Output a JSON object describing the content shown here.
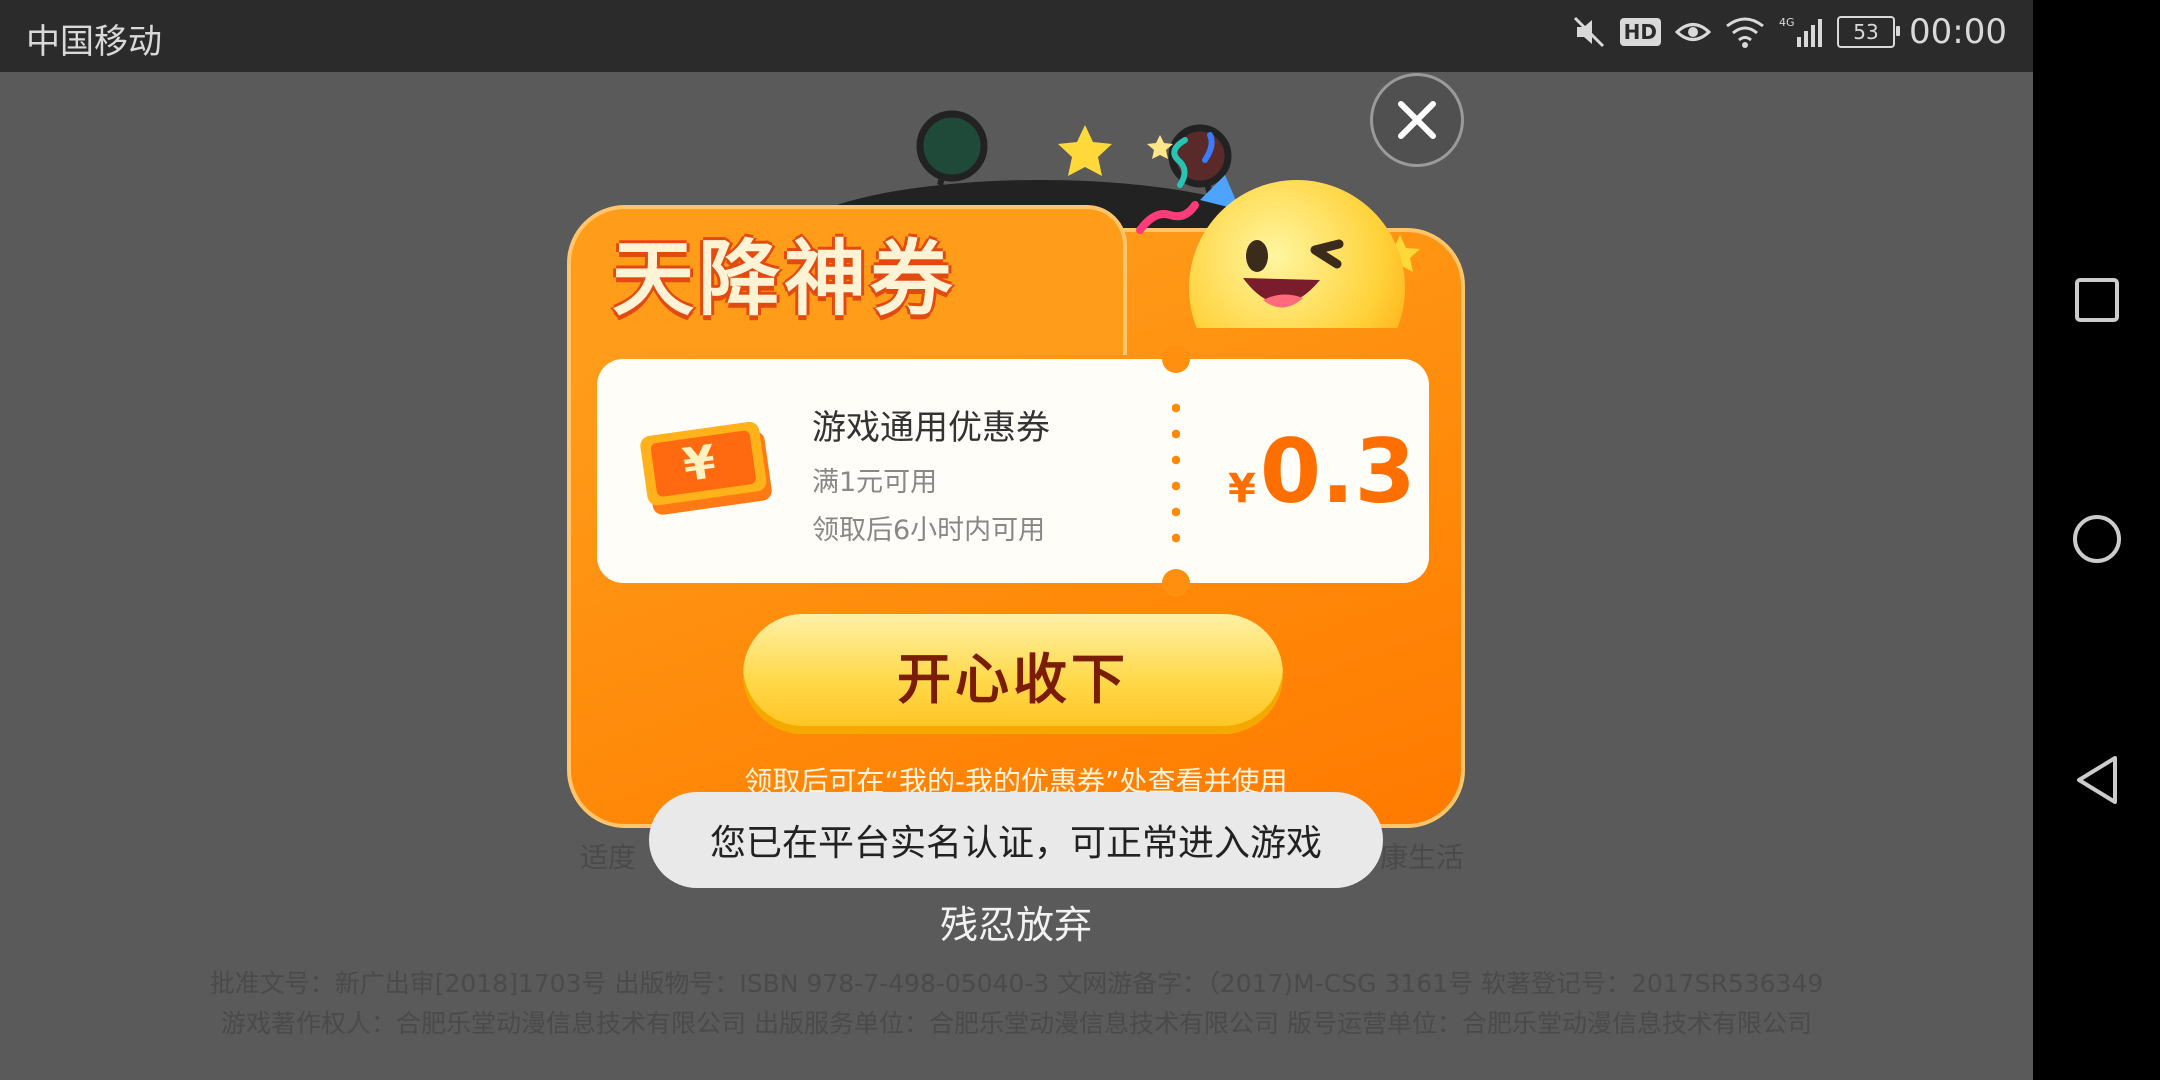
{
  "status_bar": {
    "carrier": "中国移动",
    "hd_badge": "HD",
    "network": "4G",
    "battery": "53",
    "time": "00:00"
  },
  "background_page": {
    "left_fragment": "适度",
    "right_fragment": "康生活",
    "legal_line_1": "批准文号：新广出审[2018]1703号 出版物号：ISBN 978-7-498-05040-3 文网游备字：（2017)M-CSG 3161号 软著登记号：2017SR536349",
    "legal_line_2": "游戏著作权人：合肥乐堂动漫信息技术有限公司 出版服务单位：合肥乐堂动漫信息技术有限公司 版号运营单位：合肥乐堂动漫信息技术有限公司"
  },
  "popup": {
    "title": "天降神券",
    "coupon": {
      "name": "游戏通用优惠券",
      "condition": "满1元可用",
      "validity": "领取后6小时内可用",
      "currency": "¥",
      "amount": "0.3"
    },
    "accept_label": "开心收下",
    "hint": "领取后可在“我的-我的优惠券”处查看并使用",
    "give_up_label": "残忍放弃"
  },
  "toast": {
    "message": "您已在平台实名认证，可正常进入游戏"
  },
  "colors": {
    "accent_orange": "#ff8a0a",
    "button_yellow": "#ffd94a",
    "amount_orange": "#ff6f00"
  }
}
